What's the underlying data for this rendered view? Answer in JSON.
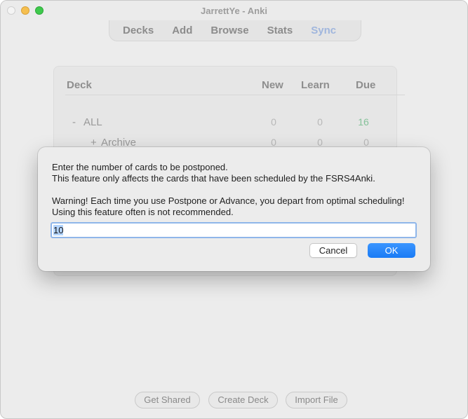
{
  "window": {
    "title": "JarrettYe - Anki"
  },
  "toolbar": {
    "items": [
      "Decks",
      "Add",
      "Browse",
      "Stats",
      "Sync"
    ]
  },
  "deck_table": {
    "headers": {
      "deck": "Deck",
      "new": "New",
      "learn": "Learn",
      "due": "Due"
    },
    "rows": [
      {
        "toggle": "-",
        "name": "ALL",
        "new": "0",
        "learn": "0",
        "due": "16"
      },
      {
        "toggle": "+",
        "name": "Archive",
        "new": "0",
        "learn": "0",
        "due": "0"
      }
    ]
  },
  "bottom_buttons": [
    "Get Shared",
    "Create Deck",
    "Import File"
  ],
  "dialog": {
    "line1": "Enter the number of cards to be postponed.",
    "line2": "This feature only affects the cards that have been scheduled by the FSRS4Anki.",
    "line3": "Warning! Each time you use Postpone or Advance, you depart from optimal scheduling!",
    "line4": "Using this feature often is not recommended.",
    "input_value": "10",
    "cancel_label": "Cancel",
    "ok_label": "OK"
  },
  "colors": {
    "due_count": "#86c29a",
    "ok_button": "#1a7bf5",
    "sync_link": "#a0b6dd",
    "input_focus": "#8fb6ea"
  }
}
